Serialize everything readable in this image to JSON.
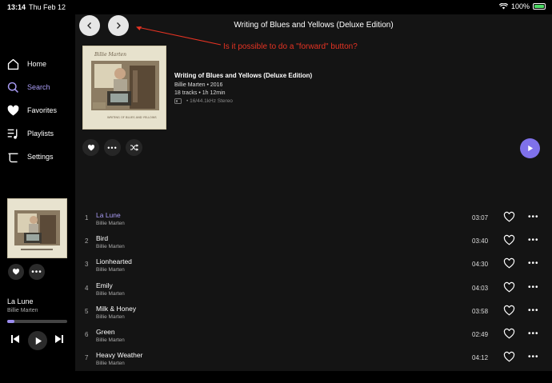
{
  "status": {
    "time": "13:14",
    "date": "Thu Feb 12",
    "battery": "100%"
  },
  "sidebar": {
    "items": [
      {
        "label": "Home",
        "icon": "home-icon"
      },
      {
        "label": "Search",
        "icon": "search-icon"
      },
      {
        "label": "Favorites",
        "icon": "heart-icon"
      },
      {
        "label": "Playlists",
        "icon": "playlist-icon"
      },
      {
        "label": "Settings",
        "icon": "settings-icon"
      }
    ],
    "active": "Search"
  },
  "mini_player": {
    "title": "La Lune",
    "artist": "Billie Marten",
    "progress": 0.12
  },
  "header": {
    "title": "Writing of Blues and Yellows (Deluxe Edition)",
    "annotation": "Is it possible to do a \"forward\" button?"
  },
  "album": {
    "title": "Writing of Blues and Yellows (Deluxe Edition)",
    "artist_year": "Billie Marten • 2016",
    "tracks_duration": "18 tracks • 1h 12min",
    "quality": "• 16/44.1kHz Stereo",
    "art_text": "Billie Marten"
  },
  "tracks": [
    {
      "num": "1",
      "title": "La Lune",
      "artist": "Billie Marten",
      "duration": "03:07",
      "active": true
    },
    {
      "num": "2",
      "title": "Bird",
      "artist": "Billie Marten",
      "duration": "03:40"
    },
    {
      "num": "3",
      "title": "Lionhearted",
      "artist": "Billie Marten",
      "duration": "04:30"
    },
    {
      "num": "4",
      "title": "Emily",
      "artist": "Billie Marten",
      "duration": "04:03"
    },
    {
      "num": "5",
      "title": "Milk & Honey",
      "artist": "Billie Marten",
      "duration": "03:58"
    },
    {
      "num": "6",
      "title": "Green",
      "artist": "Billie Marten",
      "duration": "02:49"
    },
    {
      "num": "7",
      "title": "Heavy Weather",
      "artist": "Billie Marten",
      "duration": "04:12"
    }
  ],
  "colors": {
    "accent": "#7f71ea",
    "annotation": "#e63323"
  }
}
